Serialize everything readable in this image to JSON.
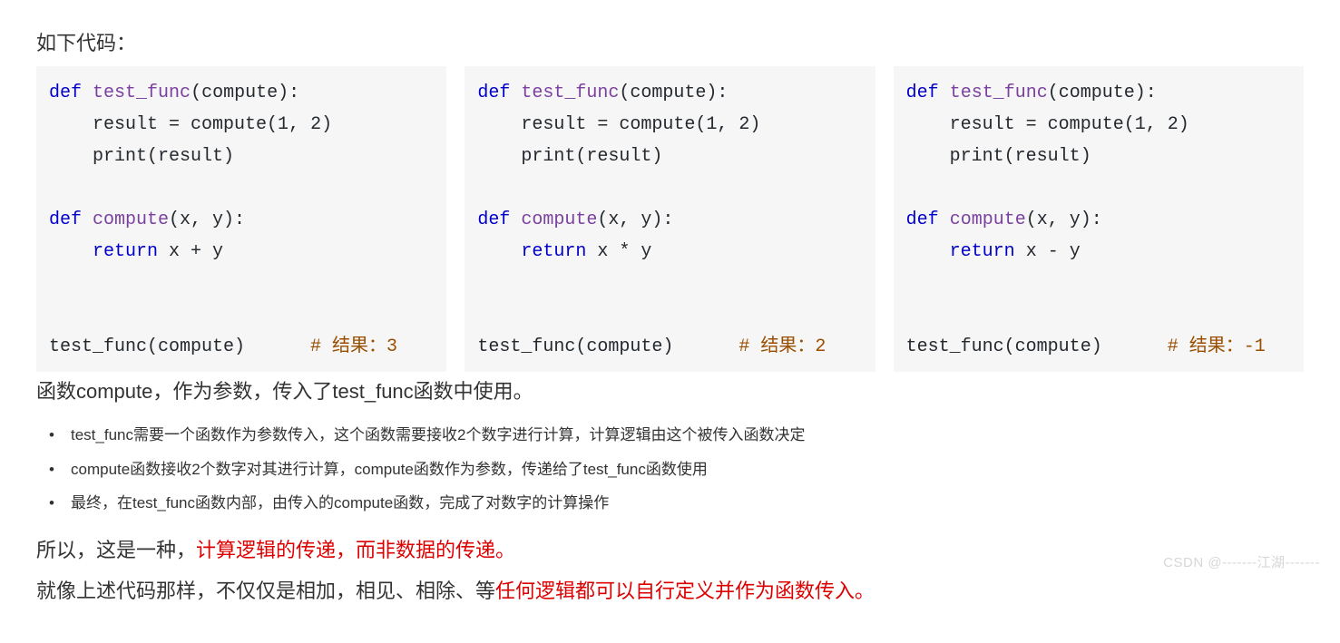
{
  "heading": "如下代码：",
  "code_blocks": [
    {
      "lines": [
        [
          {
            "cls": "kw",
            "t": "def"
          },
          {
            "cls": "",
            "t": " "
          },
          {
            "cls": "fn",
            "t": "test_func"
          },
          {
            "cls": "",
            "t": "(compute):"
          }
        ],
        [
          {
            "cls": "",
            "t": "    result = compute("
          },
          {
            "cls": "",
            "t": "1"
          },
          {
            "cls": "",
            "t": ", "
          },
          {
            "cls": "",
            "t": "2"
          },
          {
            "cls": "",
            "t": ")"
          }
        ],
        [
          {
            "cls": "",
            "t": "    print(result)"
          }
        ],
        [
          {
            "cls": "",
            "t": ""
          }
        ],
        [
          {
            "cls": "kw",
            "t": "def"
          },
          {
            "cls": "",
            "t": " "
          },
          {
            "cls": "fn",
            "t": "compute"
          },
          {
            "cls": "",
            "t": "(x, y):"
          }
        ],
        [
          {
            "cls": "",
            "t": "    "
          },
          {
            "cls": "kw",
            "t": "return"
          },
          {
            "cls": "",
            "t": " x + y"
          }
        ],
        [
          {
            "cls": "",
            "t": ""
          }
        ],
        [
          {
            "cls": "",
            "t": ""
          }
        ],
        [
          {
            "cls": "",
            "t": "test_func(compute)      "
          },
          {
            "cls": "cm",
            "t": "# 结果：3"
          }
        ]
      ]
    },
    {
      "lines": [
        [
          {
            "cls": "kw",
            "t": "def"
          },
          {
            "cls": "",
            "t": " "
          },
          {
            "cls": "fn",
            "t": "test_func"
          },
          {
            "cls": "",
            "t": "(compute):"
          }
        ],
        [
          {
            "cls": "",
            "t": "    result = compute("
          },
          {
            "cls": "",
            "t": "1"
          },
          {
            "cls": "",
            "t": ", "
          },
          {
            "cls": "",
            "t": "2"
          },
          {
            "cls": "",
            "t": ")"
          }
        ],
        [
          {
            "cls": "",
            "t": "    print(result)"
          }
        ],
        [
          {
            "cls": "",
            "t": ""
          }
        ],
        [
          {
            "cls": "kw",
            "t": "def"
          },
          {
            "cls": "",
            "t": " "
          },
          {
            "cls": "fn",
            "t": "compute"
          },
          {
            "cls": "",
            "t": "(x, y):"
          }
        ],
        [
          {
            "cls": "",
            "t": "    "
          },
          {
            "cls": "kw",
            "t": "return"
          },
          {
            "cls": "",
            "t": " x * y"
          }
        ],
        [
          {
            "cls": "",
            "t": ""
          }
        ],
        [
          {
            "cls": "",
            "t": ""
          }
        ],
        [
          {
            "cls": "",
            "t": "test_func(compute)      "
          },
          {
            "cls": "cm",
            "t": "# 结果：2"
          }
        ]
      ]
    },
    {
      "lines": [
        [
          {
            "cls": "kw",
            "t": "def"
          },
          {
            "cls": "",
            "t": " "
          },
          {
            "cls": "fn",
            "t": "test_func"
          },
          {
            "cls": "",
            "t": "(compute):"
          }
        ],
        [
          {
            "cls": "",
            "t": "    result = compute("
          },
          {
            "cls": "",
            "t": "1"
          },
          {
            "cls": "",
            "t": ", "
          },
          {
            "cls": "",
            "t": "2"
          },
          {
            "cls": "",
            "t": ")"
          }
        ],
        [
          {
            "cls": "",
            "t": "    print(result)"
          }
        ],
        [
          {
            "cls": "",
            "t": ""
          }
        ],
        [
          {
            "cls": "kw",
            "t": "def"
          },
          {
            "cls": "",
            "t": " "
          },
          {
            "cls": "fn",
            "t": "compute"
          },
          {
            "cls": "",
            "t": "(x, y):"
          }
        ],
        [
          {
            "cls": "",
            "t": "    "
          },
          {
            "cls": "kw",
            "t": "return"
          },
          {
            "cls": "",
            "t": " x - y"
          }
        ],
        [
          {
            "cls": "",
            "t": ""
          }
        ],
        [
          {
            "cls": "",
            "t": ""
          }
        ],
        [
          {
            "cls": "",
            "t": "test_func(compute)      "
          },
          {
            "cls": "cm",
            "t": "# 结果：-1"
          }
        ]
      ]
    }
  ],
  "para1": "函数compute，作为参数，传入了test_func函数中使用。",
  "bullets": [
    "test_func需要一个函数作为参数传入，这个函数需要接收2个数字进行计算，计算逻辑由这个被传入函数决定",
    "compute函数接收2个数字对其进行计算，compute函数作为参数，传递给了test_func函数使用",
    "最终，在test_func函数内部，由传入的compute函数，完成了对数字的计算操作"
  ],
  "para2_pre": "所以，这是一种，",
  "para2_red": "计算逻辑的传递，而非数据的传递。",
  "para3_pre": "就像上述代码那样，不仅仅是相加，相见、相除、等",
  "para3_red": "任何逻辑都可以自行定义并作为函数传入。",
  "watermark": "CSDN @-------江湖-------"
}
